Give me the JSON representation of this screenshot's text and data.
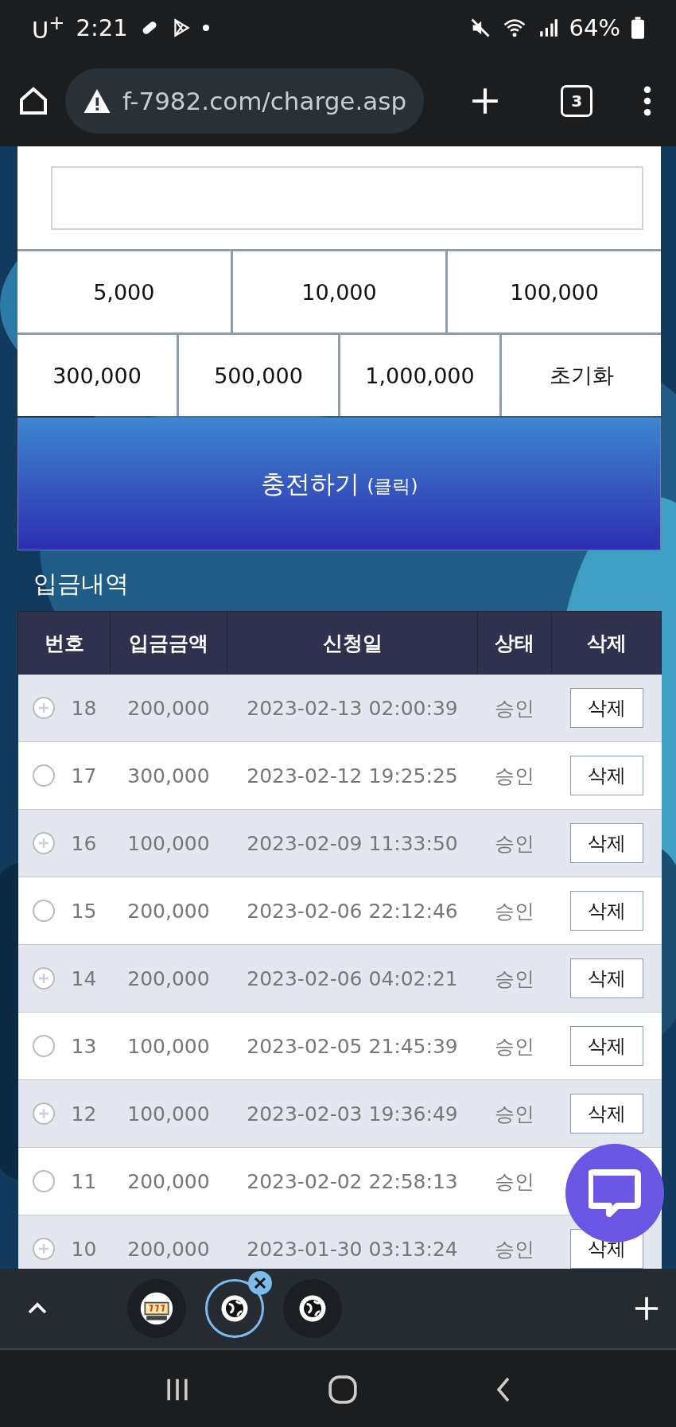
{
  "status_bar": {
    "carrier": "U$^{+}$",
    "time": "2:21",
    "battery": "64%"
  },
  "browser": {
    "url": "f-7982.com/charge.asp",
    "tab_count": "3"
  },
  "quick_amounts": [
    [
      {
        "label": "5,000"
      },
      {
        "label": "10,000"
      },
      {
        "label": "100,000"
      }
    ],
    [
      {
        "label": "300,000"
      },
      {
        "label": "500,000"
      },
      {
        "label": "1,000,000"
      },
      {
        "label": "초기화"
      }
    ]
  ],
  "charge_button": {
    "label": "충전하기",
    "note": "(클릭)"
  },
  "history": {
    "title": "입금내역",
    "columns": [
      "번호",
      "입금금액",
      "신청일",
      "상태",
      "삭제"
    ],
    "rows": [
      {
        "no": "18",
        "amount": "200,000",
        "date": "2023-02-13 02:00:39",
        "status": "승인",
        "action": "삭제"
      },
      {
        "no": "17",
        "amount": "300,000",
        "date": "2023-02-12 19:25:25",
        "status": "승인",
        "action": "삭제"
      },
      {
        "no": "16",
        "amount": "100,000",
        "date": "2023-02-09 11:33:50",
        "status": "승인",
        "action": "삭제"
      },
      {
        "no": "15",
        "amount": "200,000",
        "date": "2023-02-06 22:12:46",
        "status": "승인",
        "action": "삭제"
      },
      {
        "no": "14",
        "amount": "200,000",
        "date": "2023-02-06 04:02:21",
        "status": "승인",
        "action": "삭제"
      },
      {
        "no": "13",
        "amount": "100,000",
        "date": "2023-02-05 21:45:39",
        "status": "승인",
        "action": "삭제"
      },
      {
        "no": "12",
        "amount": "100,000",
        "date": "2023-02-03 19:36:49",
        "status": "승인",
        "action": "삭제"
      },
      {
        "no": "11",
        "amount": "200,000",
        "date": "2023-02-02 22:58:13",
        "status": "승인"
      },
      {
        "no": "10",
        "amount": "200,000",
        "date": "2023-01-30 03:13:24",
        "status": "승인",
        "action": "삭제"
      }
    ]
  },
  "tab_strip": {
    "tabs": [
      {
        "kind": "slot",
        "selected": false
      },
      {
        "kind": "globe",
        "selected": true
      },
      {
        "kind": "globe",
        "selected": false
      }
    ]
  }
}
